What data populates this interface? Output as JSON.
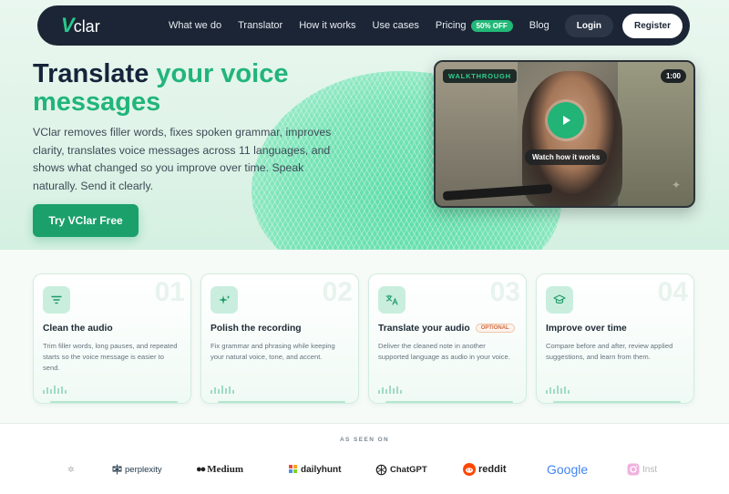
{
  "nav": {
    "logo_v": "V",
    "logo_rest": "clar",
    "links": [
      "What we do",
      "Translator",
      "How it works",
      "Use cases",
      "Pricing",
      "Blog"
    ],
    "pricing_badge": "50% OFF",
    "login": "Login",
    "register": "Register"
  },
  "hero": {
    "title_part1": "Translate ",
    "title_accent": "your voice messages",
    "description": "VClar removes filler words, fixes spoken grammar, improves clarity, translates voice messages across 11 languages, and shows what changed so you improve over time. Speak naturally. Send it clearly.",
    "cta": "Try VClar Free"
  },
  "video": {
    "badge": "WALKTHROUGH",
    "duration": "1:00",
    "watch_label": "Watch how it works"
  },
  "cards": [
    {
      "num": "01",
      "title": "Clean the audio",
      "icon": "filter-lines-icon",
      "optional": "",
      "desc": "Trim filler words, long pauses, and repeated starts so the voice message is easier to send."
    },
    {
      "num": "02",
      "title": "Polish the recording",
      "icon": "sparkles-icon",
      "optional": "",
      "desc": "Fix grammar and phrasing while keeping your natural voice, tone, and accent."
    },
    {
      "num": "03",
      "title": "Translate your audio",
      "icon": "translate-icon",
      "optional": "OPTIONAL",
      "desc": "Deliver the cleaned note in another supported language as audio in your voice."
    },
    {
      "num": "04",
      "title": "Improve over time",
      "icon": "graduation-cap-icon",
      "optional": "",
      "desc": "Compare before and after, review applied suggestions, and learn from them."
    }
  ],
  "seen_on": {
    "title": "AS SEEN ON",
    "logos": [
      "perplexity",
      "Medium",
      "dailyhunt",
      "ChatGPT",
      "reddit",
      "Google",
      "Inst"
    ]
  },
  "colors": {
    "brand_green": "#21b57a",
    "nav_bg": "#1c2535",
    "optional_orange": "#d46a3a"
  }
}
